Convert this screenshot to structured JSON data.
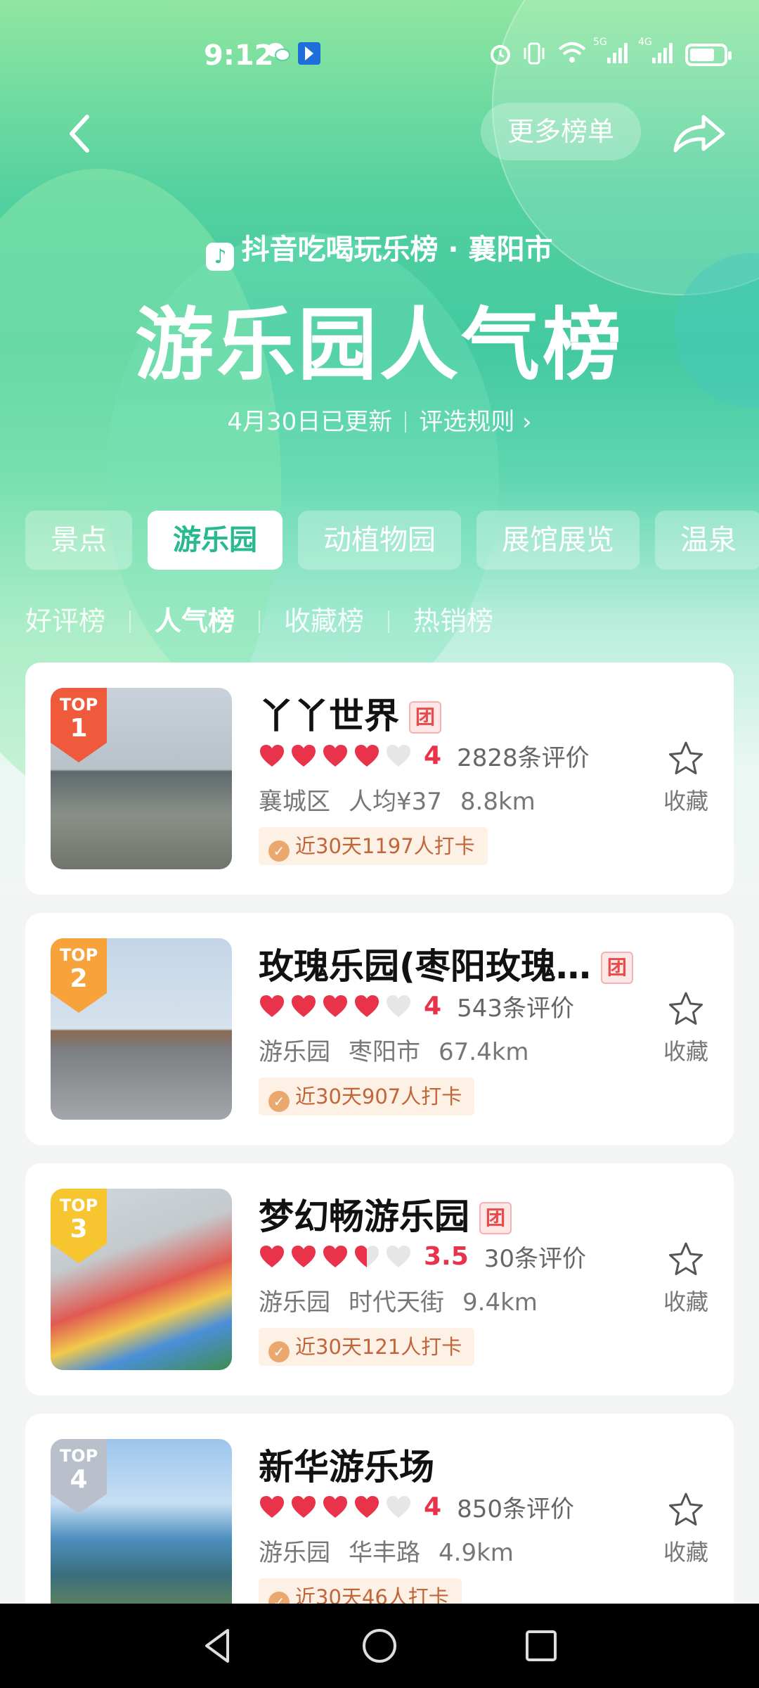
{
  "status": {
    "time": "9:12",
    "icons": [
      "wechat-icon",
      "app-notification-icon",
      "alarm-icon",
      "vibrate-icon",
      "wifi-icon",
      "signal-5g-icon",
      "signal-4g-icon",
      "battery-icon"
    ],
    "signal_5g": "5G",
    "signal_4g": "4G"
  },
  "header": {
    "more_label": "更多榜单",
    "brand": "抖音吃喝玩乐榜 · 襄阳市",
    "title": "游乐园人气榜",
    "updated": "4月30日已更新",
    "rules": "评选规则",
    "rules_arrow": "›"
  },
  "category_tabs": [
    {
      "label": "景点",
      "active": false
    },
    {
      "label": "游乐园",
      "active": true
    },
    {
      "label": "动植物园",
      "active": false
    },
    {
      "label": "展馆展览",
      "active": false
    },
    {
      "label": "温泉",
      "active": false
    }
  ],
  "sub_tabs": [
    {
      "label": "好评榜",
      "active": false
    },
    {
      "label": "人气榜",
      "active": true
    },
    {
      "label": "收藏榜",
      "active": false
    },
    {
      "label": "热销榜",
      "active": false
    }
  ],
  "items": [
    {
      "top": "TOP",
      "rank": "1",
      "badge_color": "#f05a3c",
      "name": "丫丫世界",
      "tuan": "团",
      "score": 4,
      "score_label": "4",
      "reviews": "2828条评价",
      "meta": [
        "襄城区",
        "人均¥37",
        "8.8km"
      ],
      "checkin": "近30天1197人打卡",
      "fav_label": "收藏"
    },
    {
      "top": "TOP",
      "rank": "2",
      "badge_color": "#f7a23a",
      "name": "玫瑰乐园(枣阳玫瑰…",
      "tuan": "团",
      "score": 4,
      "score_label": "4",
      "reviews": "543条评价",
      "meta": [
        "游乐园",
        "枣阳市",
        "67.4km"
      ],
      "checkin": "近30天907人打卡",
      "fav_label": "收藏"
    },
    {
      "top": "TOP",
      "rank": "3",
      "badge_color": "#f7c530",
      "name": "梦幻畅游乐园",
      "tuan": "团",
      "score": 3.5,
      "score_label": "3.5",
      "reviews": "30条评价",
      "meta": [
        "游乐园",
        "时代天街",
        "9.4km"
      ],
      "checkin": "近30天121人打卡",
      "fav_label": "收藏"
    },
    {
      "top": "TOP",
      "rank": "4",
      "badge_color": "#b9c0cc",
      "name": "新华游乐场",
      "tuan": "",
      "score": 4,
      "score_label": "4",
      "reviews": "850条评价",
      "meta": [
        "游乐园",
        "华丰路",
        "4.9km"
      ],
      "checkin": "近30天46人打卡",
      "fav_label": "收藏"
    }
  ],
  "colors": {
    "accent": "#27b98f",
    "heart": "#e8334a",
    "heart_empty": "#e6e6e6"
  }
}
